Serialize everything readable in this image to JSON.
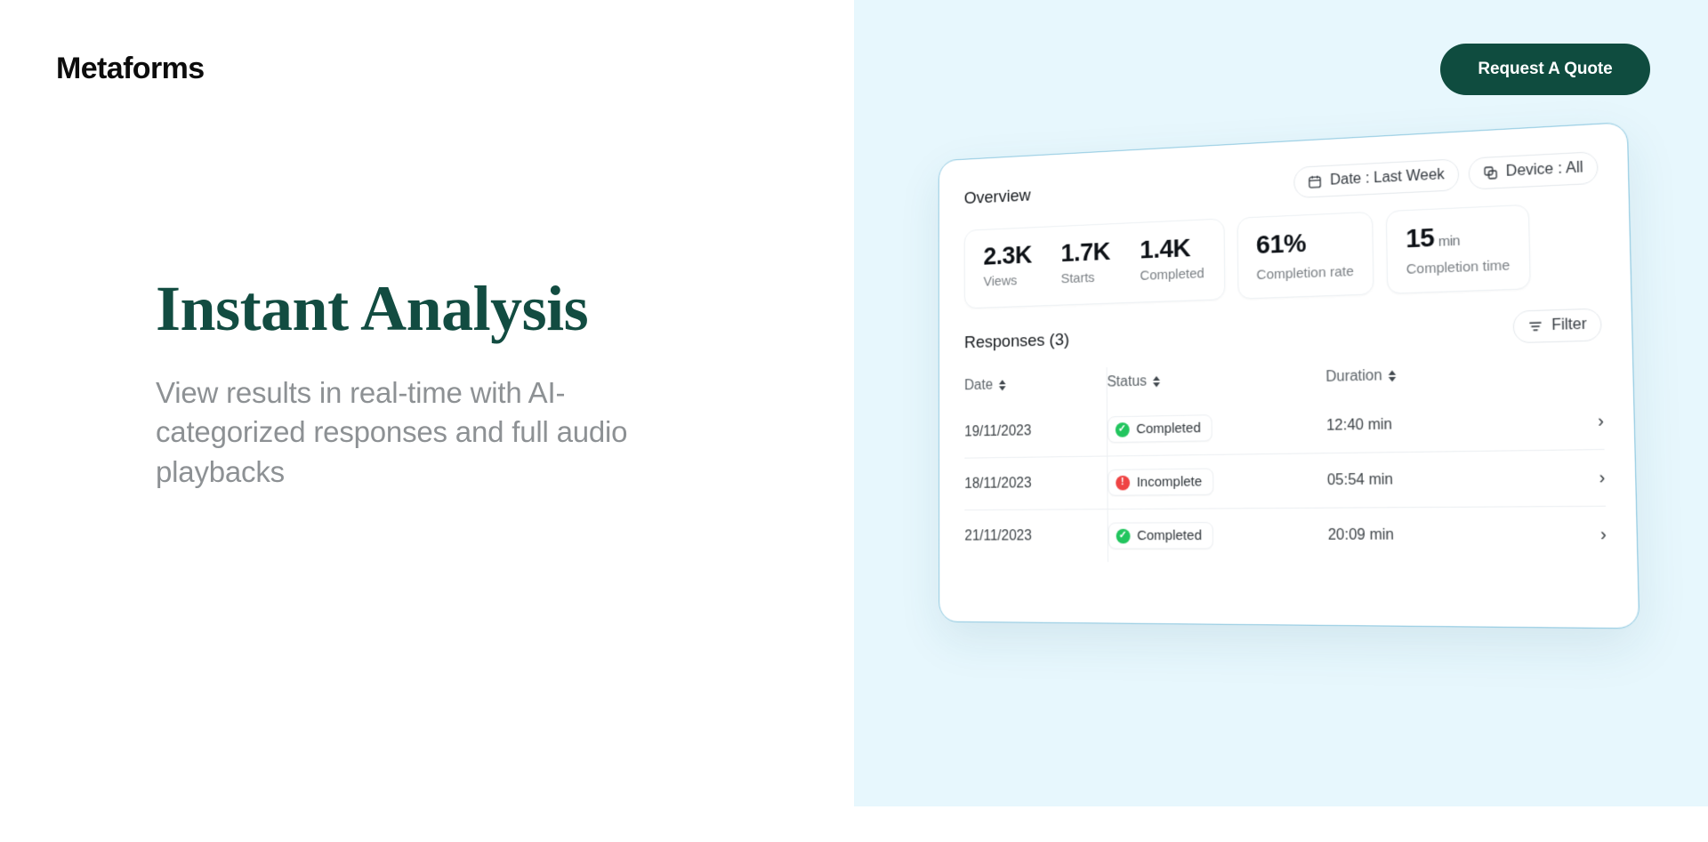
{
  "brand": {
    "logo": "Metaforms"
  },
  "header": {
    "cta_label": "Request A Quote"
  },
  "hero": {
    "title": "Instant Analysis",
    "subtitle": "View results in real-time with AI-categorized responses and full audio playbacks"
  },
  "colors": {
    "brand_green": "#0f4c3f",
    "panel_blue": "#e7f7fd",
    "card_border": "#8ec8e0",
    "status_completed": "#22c55e",
    "status_incomplete": "#ef4444",
    "muted_text": "#8d9194"
  },
  "dashboard": {
    "overview": {
      "title": "Overview",
      "filters": [
        {
          "icon": "calendar-icon",
          "label": "Date : Last Week"
        },
        {
          "icon": "device-icon",
          "label": "Device : All"
        }
      ],
      "stat_group": [
        {
          "value": "2.3K",
          "label": "Views"
        },
        {
          "value": "1.7K",
          "label": "Starts"
        },
        {
          "value": "1.4K",
          "label": "Completed"
        }
      ],
      "stat_cards": [
        {
          "value": "61%",
          "unit": "",
          "label": "Completion rate"
        },
        {
          "value": "15",
          "unit": "min",
          "label": "Completion time"
        }
      ]
    },
    "responses": {
      "title": "Responses (3)",
      "filter_label": "Filter",
      "filter_icon": "filter-icon",
      "columns": [
        "Date",
        "Status",
        "Duration"
      ],
      "rows": [
        {
          "date": "19/11/2023",
          "status": "Completed",
          "status_type": "completed",
          "duration": "12:40 min"
        },
        {
          "date": "18/11/2023",
          "status": "Incomplete",
          "status_type": "incomplete",
          "duration": "05:54 min"
        },
        {
          "date": "21/11/2023",
          "status": "Completed",
          "status_type": "completed",
          "duration": "20:09 min"
        }
      ]
    }
  }
}
